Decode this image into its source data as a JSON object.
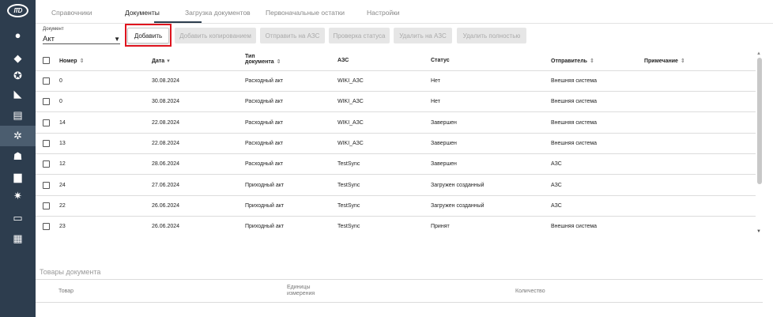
{
  "sidebar": {
    "logo": "ITD",
    "icons": [
      {
        "name": "account-icon",
        "glyph": "●"
      },
      {
        "name": "diamond-icon",
        "glyph": "◆"
      },
      {
        "name": "settings-wheel-icon",
        "glyph": "✪"
      },
      {
        "name": "tag-icon",
        "glyph": "◣"
      },
      {
        "name": "cash-register-icon",
        "glyph": "▤"
      },
      {
        "name": "network-icon",
        "glyph": "✲"
      },
      {
        "name": "users-icon",
        "glyph": "☗"
      },
      {
        "name": "fuel-icon",
        "glyph": "▆"
      },
      {
        "name": "gears-icon",
        "glyph": "✷"
      },
      {
        "name": "monitor-icon",
        "glyph": "▭"
      },
      {
        "name": "reports-icon",
        "glyph": "▦"
      }
    ],
    "active_index": 5
  },
  "tabs": [
    "Справочники",
    "Документы",
    "Загрузка документов",
    "Первоначальные остатки",
    "Настройки"
  ],
  "active_tab": "Документы",
  "document_select": {
    "label": "Документ",
    "value": "Акт"
  },
  "toolbar": {
    "add": "Добавить",
    "add_copy": "Добавить копированием",
    "send": "Отправить на АЗС",
    "check_status": "Проверка статуса",
    "delete_on_azs": "Удалить на АЗС",
    "delete_full": "Удалить полностью"
  },
  "table": {
    "headers": {
      "number": "Номер",
      "date": "Дата",
      "type_line1": "Тип",
      "type_line2": "документа",
      "azs": "АЗС",
      "status": "Статус",
      "sender": "Отправитель",
      "note": "Примечание"
    },
    "rows": [
      {
        "number": "0",
        "date": "30.08.2024",
        "type": "Расходный акт",
        "azs": "WIKI_АЗС",
        "status": "Нет",
        "sender": "Внешняя система"
      },
      {
        "number": "0",
        "date": "30.08.2024",
        "type": "Расходный акт",
        "azs": "WIKI_АЗС",
        "status": "Нет",
        "sender": "Внешняя система"
      },
      {
        "number": "14",
        "date": "22.08.2024",
        "type": "Расходный акт",
        "azs": "WIKI_АЗС",
        "status": "Завершен",
        "sender": "Внешняя система"
      },
      {
        "number": "13",
        "date": "22.08.2024",
        "type": "Расходный акт",
        "azs": "WIKI_АЗС",
        "status": "Завершен",
        "sender": "Внешняя система"
      },
      {
        "number": "12",
        "date": "28.06.2024",
        "type": "Расходный акт",
        "azs": "TestSync",
        "status": "Завершен",
        "sender": "АЗС"
      },
      {
        "number": "24",
        "date": "27.06.2024",
        "type": "Приходный акт",
        "azs": "TestSync",
        "status": "Загружен созданный",
        "sender": "АЗС"
      },
      {
        "number": "22",
        "date": "26.06.2024",
        "type": "Приходный акт",
        "azs": "TestSync",
        "status": "Загружен созданный",
        "sender": "АЗС"
      },
      {
        "number": "23",
        "date": "26.06.2024",
        "type": "Приходный акт",
        "azs": "TestSync",
        "status": "Принят",
        "sender": "Внешняя система"
      }
    ]
  },
  "goods": {
    "title": "Товары документа",
    "col_product": "Товар",
    "col_unit_line1": "Единицы",
    "col_unit_line2": "измерения",
    "col_quantity": "Количество"
  },
  "colors": {
    "sidebar": "#2d3d4e",
    "highlight": "#e0141e",
    "disabled_button": "#e6e6e6"
  }
}
